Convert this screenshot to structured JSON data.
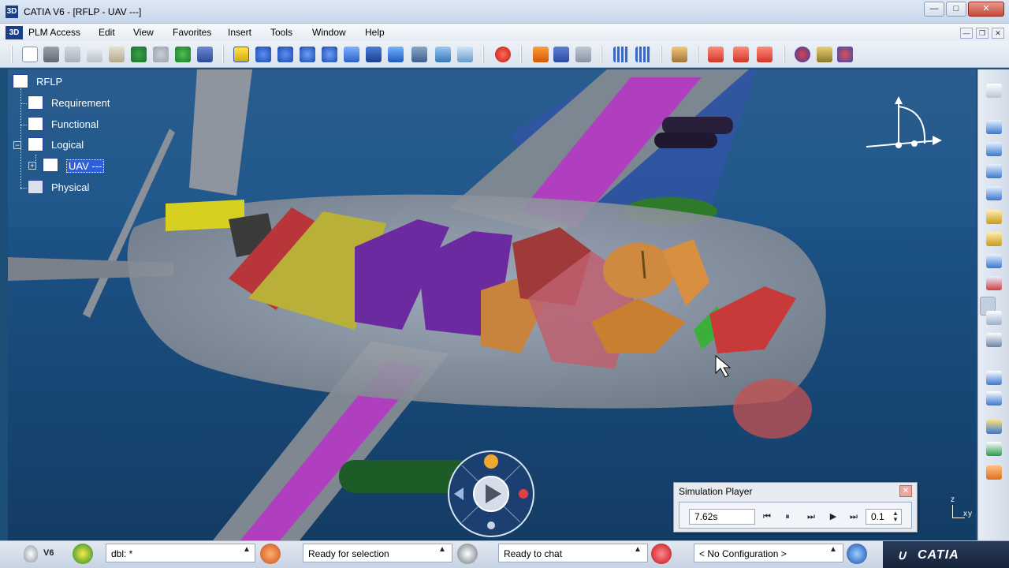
{
  "window": {
    "title": "CATIA V6 - [RFLP - UAV ---]",
    "icon_label": "3D"
  },
  "menu": {
    "items": [
      "PLM Access",
      "Edit",
      "View",
      "Favorites",
      "Insert",
      "Tools",
      "Window",
      "Help"
    ]
  },
  "tree": {
    "root": "RFLP",
    "items": [
      {
        "label": "Requirement",
        "icon": "requirement-icon"
      },
      {
        "label": "Functional",
        "icon": "functional-icon"
      },
      {
        "label": "Logical",
        "icon": "logical-icon",
        "expanded": true
      },
      {
        "label": "UAV ---",
        "icon": "logical-component-icon",
        "selected": true
      },
      {
        "label": "Physical",
        "icon": "physical-icon"
      }
    ],
    "collapsed_glyph": "+",
    "expanded_glyph": "−"
  },
  "simulation_player": {
    "title": "Simulation Player",
    "time": "7.62s",
    "step": "0.1",
    "controls": [
      "⏮",
      "⏸",
      "⏭",
      "▶",
      "⏭"
    ]
  },
  "status": {
    "version": "V6",
    "command_field": "dbl: *",
    "selection_status": "Ready for selection",
    "chat_status": "Ready to chat",
    "configuration": "< No Configuration >",
    "brand": "CATIA"
  },
  "compass": {
    "axis_labels": {
      "z": "z",
      "x": "x",
      "y": "y"
    }
  },
  "colors": {
    "viewport_bg": "#1f568a",
    "fuselage": "#8a9099",
    "wing_stripe": "#b03fc0",
    "block_red": "#b8353a",
    "block_yellow": "#b8b038",
    "block_purple": "#6b2aa0",
    "block_orange": "#cc8540",
    "block_green": "#2e8a2e",
    "selection": "#3060d8"
  }
}
